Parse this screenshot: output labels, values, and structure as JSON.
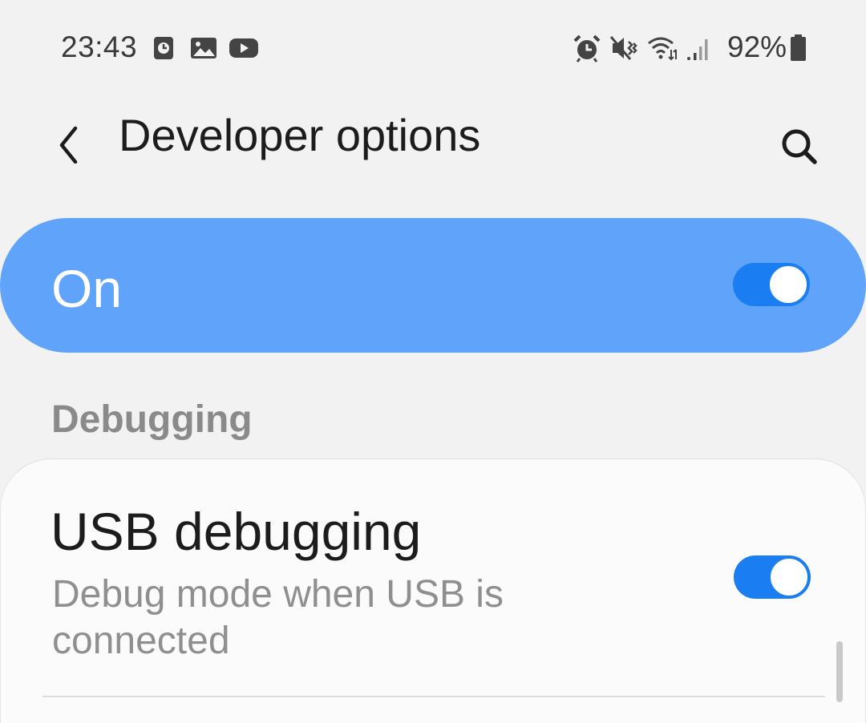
{
  "status_bar": {
    "time": "23:43",
    "left_icons": [
      "screen-time-icon",
      "gallery-icon",
      "youtube-icon"
    ],
    "right_icons": [
      "alarm-icon",
      "mute-vibrate-icon",
      "wifi-icon",
      "cell-signal-icon"
    ],
    "battery_text": "92%",
    "battery_level": 0.92
  },
  "app_bar": {
    "title": "Developer options",
    "back_icon": "back-chevron-icon",
    "search_icon": "search-icon"
  },
  "master_switch": {
    "label": "On",
    "checked": true
  },
  "sections": [
    {
      "header": "Debugging",
      "items": [
        {
          "title": "USB debugging",
          "summary": "Debug mode when USB is connected",
          "checked": true
        }
      ]
    }
  ],
  "colors": {
    "accent": "#1a7df2",
    "master_bar": "#60a3fa",
    "background": "#f2f2f2"
  }
}
